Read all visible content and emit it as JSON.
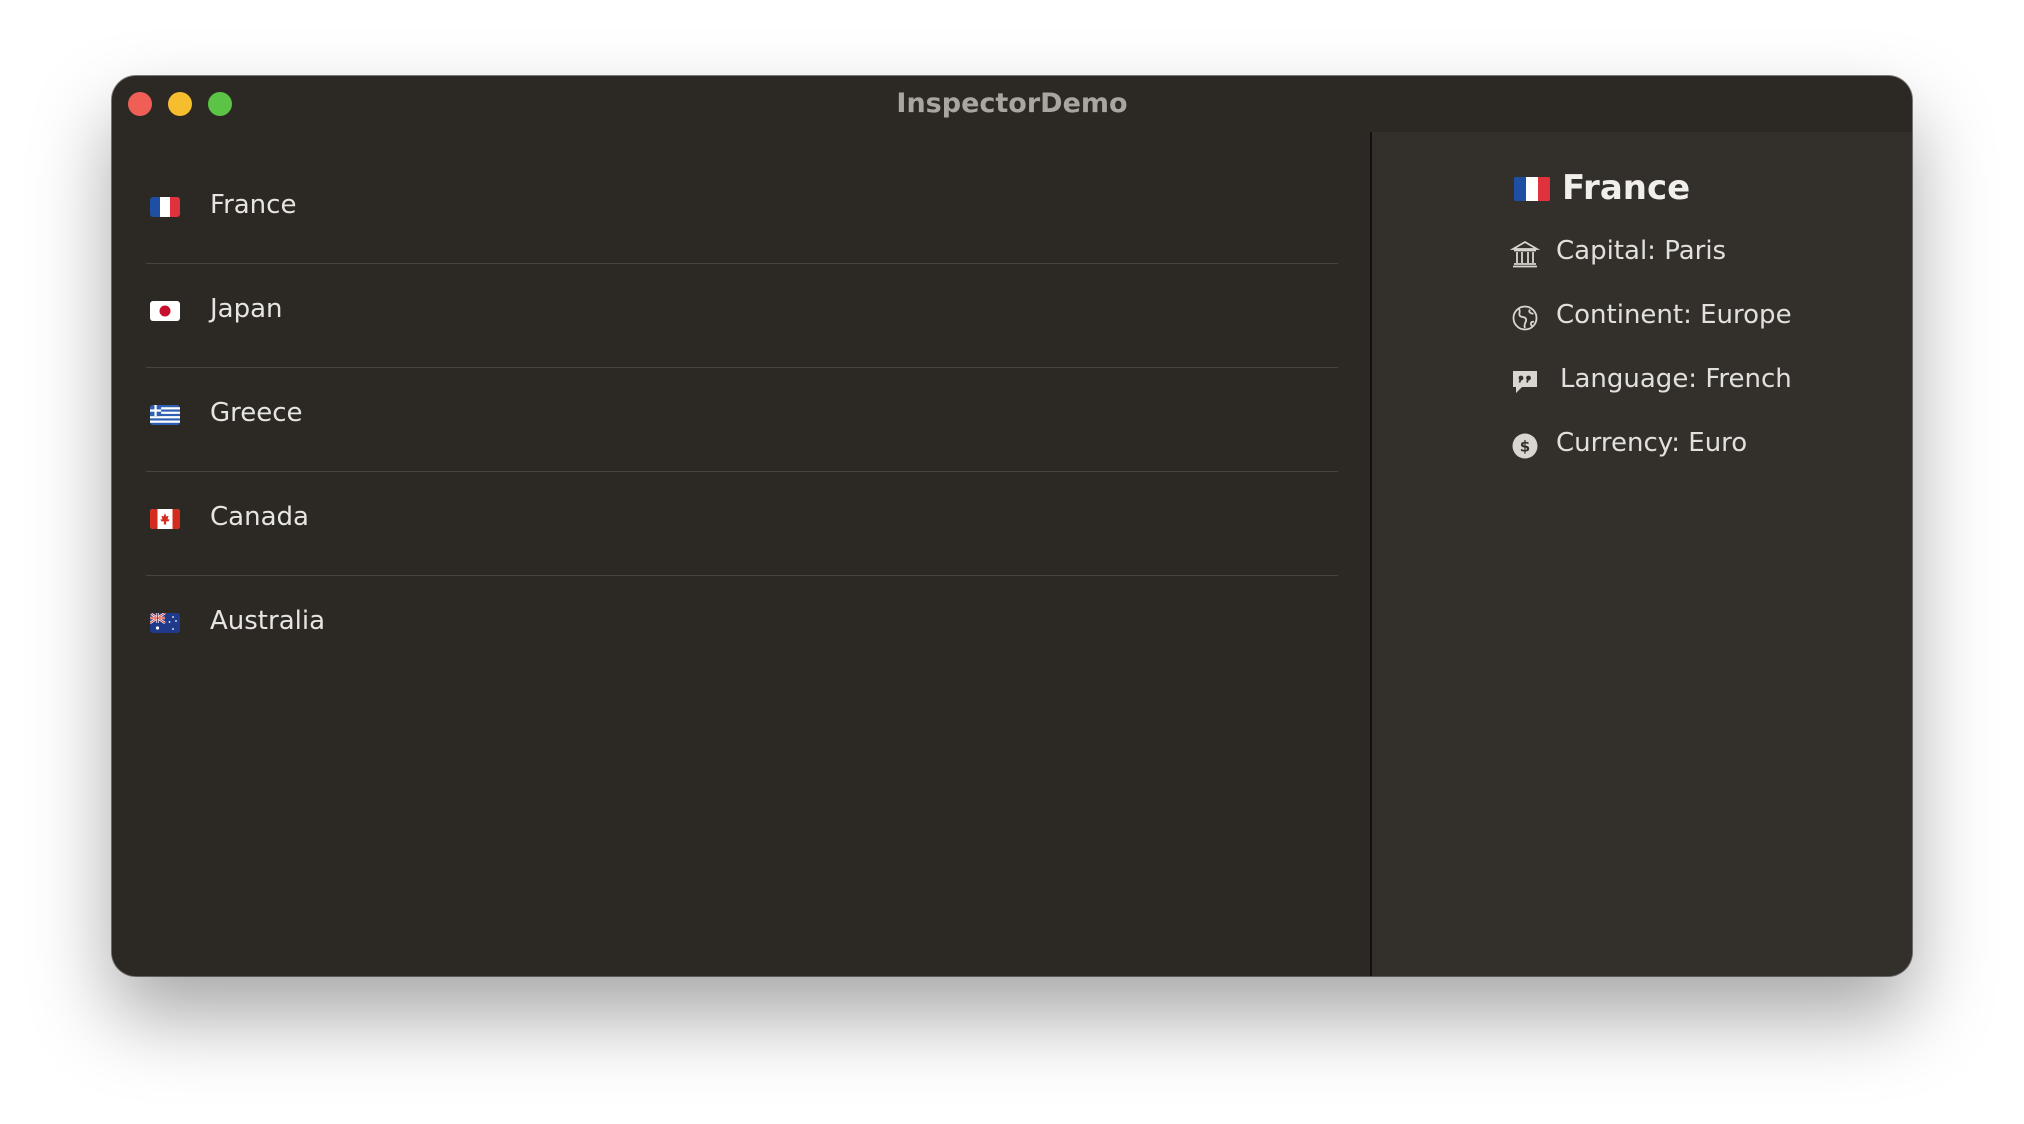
{
  "window": {
    "title": "InspectorDemo"
  },
  "countries": [
    {
      "name": "France",
      "flag_icon": "france-flag-icon"
    },
    {
      "name": "Japan",
      "flag_icon": "japan-flag-icon"
    },
    {
      "name": "Greece",
      "flag_icon": "greece-flag-icon"
    },
    {
      "name": "Canada",
      "flag_icon": "canada-flag-icon"
    },
    {
      "name": "Australia",
      "flag_icon": "australia-flag-icon"
    }
  ],
  "inspector": {
    "title": "France",
    "flag_icon": "france-flag-icon",
    "capital": "Capital: Paris",
    "continent": "Continent: Europe",
    "language": "Language: French",
    "currency": "Currency: Euro",
    "icons": {
      "capital": "building-columns-icon",
      "continent": "globe-icon",
      "language": "speech-bubble-quote-icon",
      "currency": "dollar-circle-icon"
    }
  },
  "colors": {
    "window_bg": "#2c2924",
    "inspector_bg": "#33302b",
    "close": "#ef5f56",
    "minimize": "#f6bd2f",
    "maximize": "#5bc447"
  }
}
